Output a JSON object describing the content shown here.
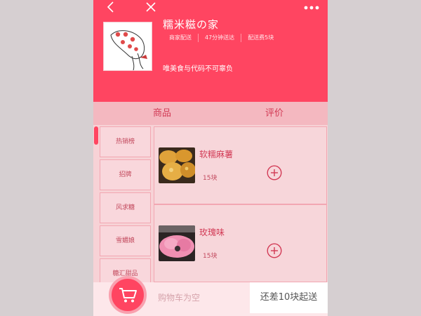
{
  "header": {
    "shop_name": "糯米糍の家",
    "meta": [
      "商家配送",
      "47分钟送达",
      "配送费5块"
    ],
    "slogan": "唯美食与代码不可辜负",
    "icons": [
      "back-icon",
      "close-icon",
      "more-icon"
    ]
  },
  "tabs": [
    {
      "label": "商品",
      "active": true
    },
    {
      "label": "评价",
      "active": false
    }
  ],
  "categories": [
    "热销榜",
    "招牌",
    "风求糖",
    "雪媚娘",
    "糖汇甜品"
  ],
  "items": [
    {
      "name": "软糯麻薯",
      "price": "15块"
    },
    {
      "name": "玫瑰味",
      "price": "15块"
    }
  ],
  "cart": {
    "empty_text": "购物车为空",
    "min_order_text": "还差10块起送"
  },
  "colors": {
    "primary": "#ff4561",
    "background": "#f7d2d6",
    "tab_bar": "#f4b8c0",
    "cart_bar": "#fde7ea"
  }
}
